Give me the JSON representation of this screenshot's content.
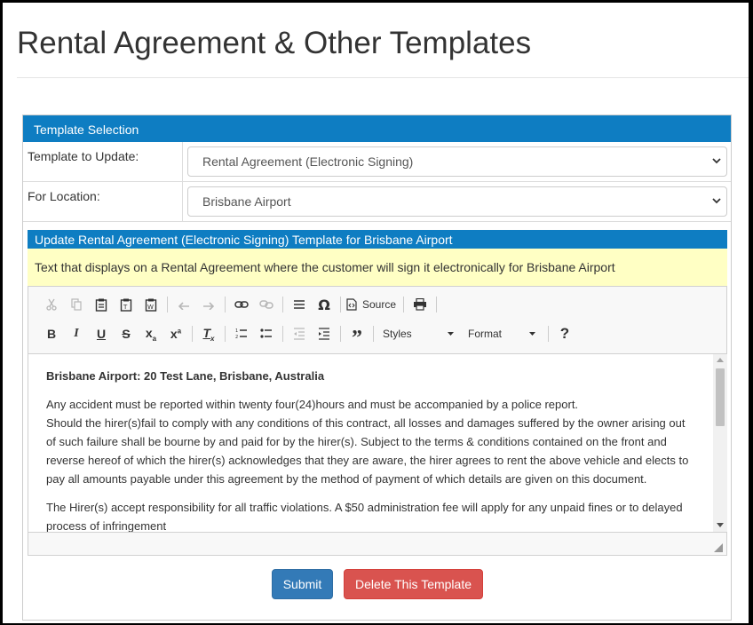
{
  "page": {
    "title": "Rental Agreement & Other Templates"
  },
  "panel": {
    "heading": "Template Selection",
    "template_label": "Template to Update:",
    "template_value": "Rental Agreement (Electronic Signing)",
    "location_label": "For Location:",
    "location_value": "Brisbane Airport"
  },
  "update": {
    "heading": "Update Rental Agreement (Electronic Signing) Template for Brisbane Airport",
    "help": "Text that displays on a Rental Agreement where the customer will sign it electronically for Brisbane Airport"
  },
  "toolbar": {
    "source_label": "Source",
    "styles_label": "Styles",
    "format_label": "Format",
    "help_glyph": "?",
    "icons_row1": [
      "cut-icon",
      "copy-icon",
      "paste-icon",
      "paste-text-icon",
      "paste-word-icon",
      "undo-icon",
      "redo-icon",
      "link-icon",
      "unlink-icon",
      "horizontal-rule-icon",
      "special-char-icon",
      "source-icon",
      "print-icon"
    ],
    "icons_row2": [
      "bold-icon",
      "italic-icon",
      "underline-icon",
      "strike-icon",
      "subscript-icon",
      "superscript-icon",
      "remove-format-icon",
      "numbered-list-icon",
      "bulleted-list-icon",
      "outdent-icon",
      "indent-icon",
      "blockquote-icon",
      "help-icon"
    ]
  },
  "editor": {
    "heading": "Brisbane Airport: 20 Test Lane, Brisbane, Australia",
    "para1_line1": "Any accident must be reported within twenty four(24)hours and must be accompanied by a police report.",
    "para1_line2": "Should the hirer(s)fail to comply with any conditions of this contract, all losses and damages suffered by the owner arising out of such failure shall be bourne by and paid for by the hirer(s). Subject to the terms & conditions contained on the front and reverse hereof of which the hirer(s) acknowledges that they are aware, the hirer agrees to rent the above vehicle and elects to pay all amounts payable under this agreement by the method of payment of which details are given on this document.",
    "para2": "The Hirer(s) accept responsibility for all traffic violations. A $50 administration fee will apply for any unpaid fines or to delayed process of infringement"
  },
  "actions": {
    "submit": "Submit",
    "delete": "Delete This Template"
  },
  "colors": {
    "panel_heading": "#0e7dc2",
    "help_bg": "#ffffc4",
    "submit": "#337ab7",
    "delete": "#d9534f"
  }
}
